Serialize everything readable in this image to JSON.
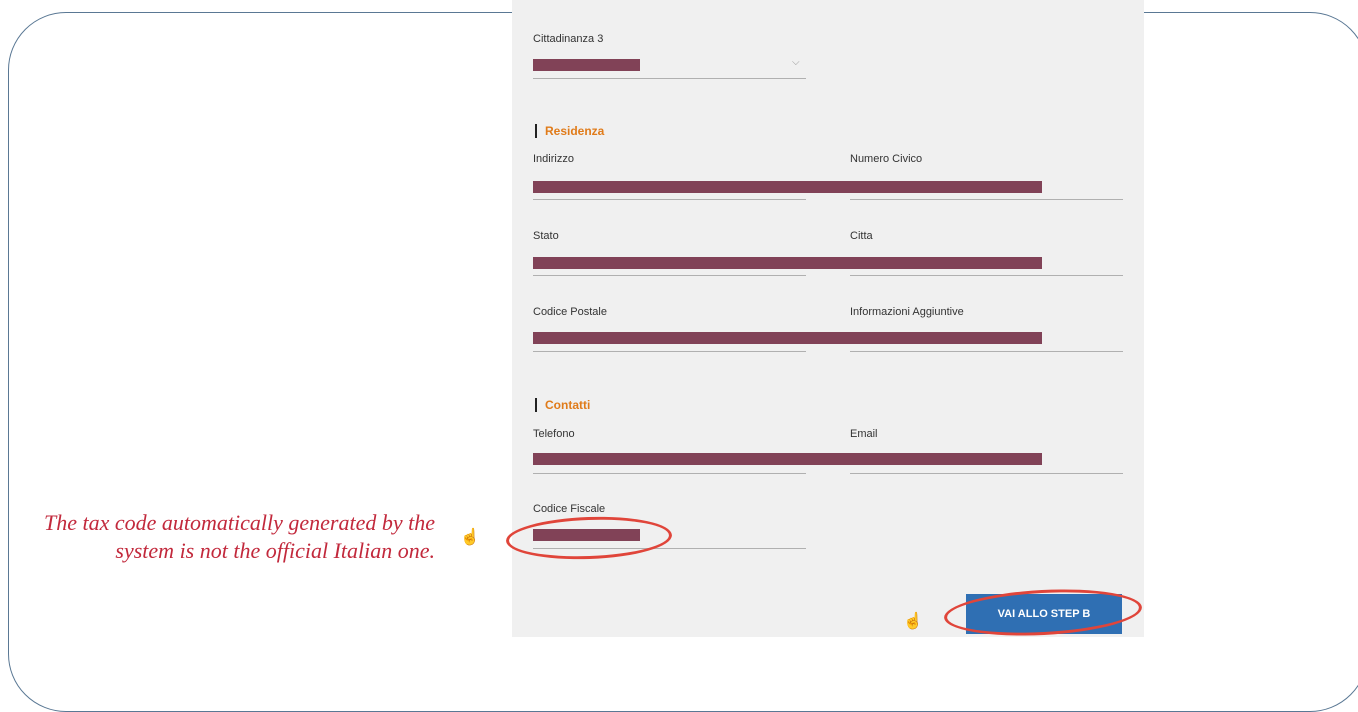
{
  "form": {
    "cittadinanza3": {
      "label": "Cittadinanza 3"
    },
    "residenza": {
      "title": "Residenza",
      "indirizzo": "Indirizzo",
      "numero_civico": "Numero Civico",
      "stato": "Stato",
      "citta": "Citta",
      "codice_postale": "Codice Postale",
      "info_aggiuntive": "Informazioni Aggiuntive"
    },
    "contatti": {
      "title": "Contatti",
      "telefono": "Telefono",
      "email": "Email"
    },
    "codice_fiscale": "Codice Fiscale",
    "next_button": "VAI ALLO STEP B"
  },
  "annotation": {
    "note": "The tax code automatically generated by the system is not the official Italian one."
  },
  "icons": {
    "chevron": "chevron-down-icon",
    "cursor": "pointer-click-icon"
  },
  "colors": {
    "accent": "#e07b1a",
    "redaction": "#814257",
    "button": "#2f6fb3",
    "annotation": "#c2293c"
  }
}
